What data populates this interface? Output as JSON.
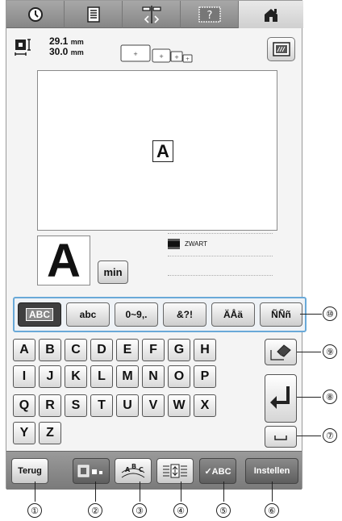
{
  "tabs": [
    {
      "name": "clock-icon"
    },
    {
      "name": "document-icon"
    },
    {
      "name": "mirror-icon"
    },
    {
      "name": "help-icon"
    },
    {
      "name": "home-icon"
    }
  ],
  "size": {
    "height": "29.1",
    "width": "30.0",
    "unit": "mm"
  },
  "canvas": {
    "letter": "A"
  },
  "preview": {
    "letter": "A",
    "min_label": "min"
  },
  "thread": {
    "color_name": "ZWART"
  },
  "categories": [
    {
      "label": "ABC",
      "active": true
    },
    {
      "label": "abc",
      "active": false
    },
    {
      "label": "0~9,.",
      "active": false
    },
    {
      "label": "&?!",
      "active": false
    },
    {
      "label": "ÄÅä",
      "active": false
    },
    {
      "label": "ÑÑñ",
      "active": false
    }
  ],
  "keyboard": {
    "row1": [
      "A",
      "B",
      "C",
      "D",
      "E",
      "F",
      "G",
      "H"
    ],
    "row2": [
      "I",
      "J",
      "K",
      "L",
      "M",
      "N",
      "O",
      "P"
    ],
    "row3": [
      "Q",
      "R",
      "S",
      "T",
      "U",
      "V",
      "W",
      "X"
    ],
    "row4": [
      "Y",
      "Z"
    ]
  },
  "bottom": {
    "back_label": "Terug",
    "check_label": "✓ABC",
    "set_label": "Instellen"
  },
  "callouts": [
    "①",
    "②",
    "③",
    "④",
    "⑤",
    "⑥",
    "⑦",
    "⑧",
    "⑨",
    "⑩"
  ],
  "colors": {
    "accent_outline": "#69a9d8",
    "tab_bar": "#8f8f8f"
  }
}
